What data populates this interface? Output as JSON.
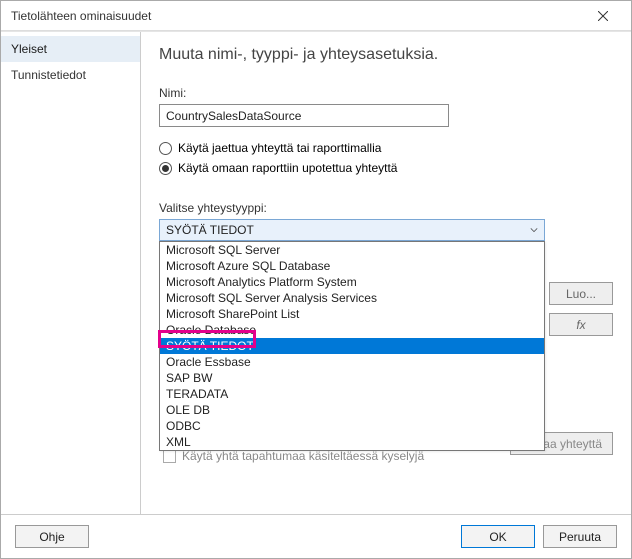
{
  "window": {
    "title": "Tietolähteen ominaisuudet"
  },
  "sidebar": {
    "tabs": [
      {
        "label": "Yleiset"
      },
      {
        "label": "Tunnistetiedot"
      }
    ]
  },
  "main": {
    "heading": "Muuta nimi-, tyyppi- ja yhteysasetuksia.",
    "name_label": "Nimi:",
    "name_value": "CountrySalesDataSource",
    "radio_shared": "Käytä jaettua yhteyttä tai raporttimallia",
    "radio_embedded": "Käytä omaan raporttiin upotettua yhteyttä",
    "conn_type_label": "Valitse yhteystyyppi:",
    "combo_selected": "SYÖTÄ TIEDOT",
    "options": [
      "Microsoft SQL Server",
      "Microsoft Azure SQL Database",
      "Microsoft Analytics Platform System",
      "Microsoft SQL Server Analysis Services",
      "Microsoft SharePoint List",
      "Oracle Database",
      "SYÖTÄ TIEDOT",
      "Oracle Essbase",
      "SAP BW",
      "TERADATA",
      "OLE DB",
      "ODBC",
      "XML"
    ],
    "build_btn": "Luo...",
    "fx_btn": "fx",
    "test_btn": "Testaa yhteyttä",
    "single_txn": "Käytä yhtä tapahtumaa käsiteltäessä kyselyjä"
  },
  "footer": {
    "help": "Ohje",
    "ok": "OK",
    "cancel": "Peruuta"
  }
}
